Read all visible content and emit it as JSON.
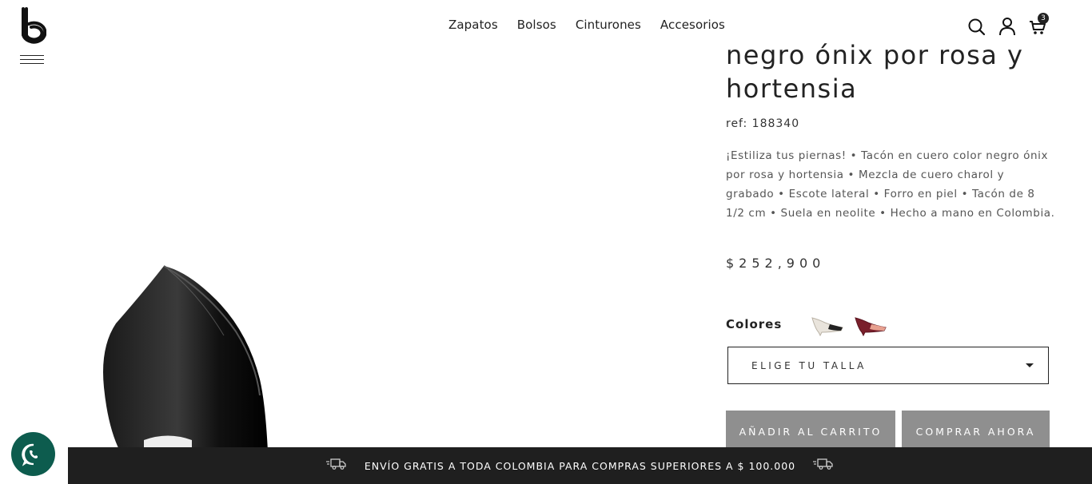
{
  "header": {
    "logo": "b",
    "nav": [
      "Zapatos",
      "Bolsos",
      "Cinturones",
      "Accesorios"
    ],
    "cart_count": "3",
    "icons": [
      "search-icon",
      "user-icon",
      "cart-icon"
    ]
  },
  "product": {
    "title": "negro ónix por rosa y hortensia",
    "ref": "ref: 188340",
    "description": "¡Estiliza tus piernas! • Tacón en cuero color negro ónix por rosa y hortensia • Mezcla de cuero charol y grabado • Escote lateral • Forro en piel • Tacón de 8 1/2 cm • Suela en neolite • Hecho a mano en Colombia.",
    "price": "$252,900",
    "colors_label": "Colores",
    "size_placeholder": "ELIGE TU TALLA",
    "add_to_cart": "AÑADIR AL CARRITO",
    "buy_now": "COMPRAR AHORA"
  },
  "shipping_bar": {
    "text": "ENVÍO GRATIS A TODA COLOMBIA PARA COMPRAS SUPERIORES A $ 100.000"
  },
  "colors": {
    "button_gray": "#8f8f8f",
    "whatsapp": "#0d5c4e",
    "bar": "#1f1f1f"
  }
}
